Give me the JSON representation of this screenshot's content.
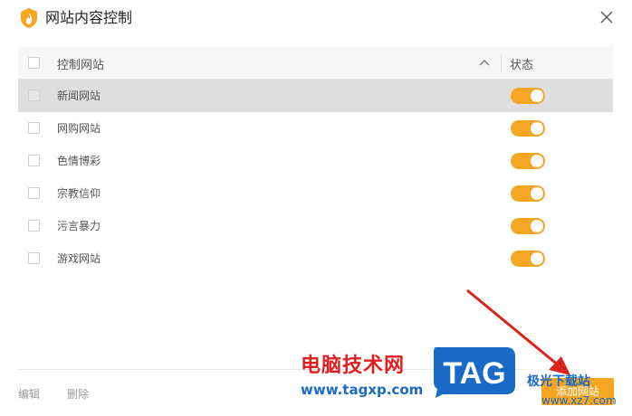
{
  "window": {
    "title": "网站内容控制",
    "icon": "shield-flame-icon",
    "close_icon": "close-icon"
  },
  "table": {
    "headers": {
      "name": "控制网站",
      "status": "状态"
    },
    "sort_icon": "chevron-up-icon",
    "rows": [
      {
        "label": "新闻网站",
        "selected": true,
        "enabled": true
      },
      {
        "label": "网购网站",
        "selected": false,
        "enabled": true
      },
      {
        "label": "色情博彩",
        "selected": false,
        "enabled": true
      },
      {
        "label": "宗教信仰",
        "selected": false,
        "enabled": true
      },
      {
        "label": "污言暴力",
        "selected": false,
        "enabled": true
      },
      {
        "label": "游戏网站",
        "selected": false,
        "enabled": true
      }
    ]
  },
  "footer": {
    "edit_label": "编辑",
    "delete_label": "删除",
    "add_button_label": "添加网站"
  },
  "watermark": {
    "site_name": "电脑技术网",
    "site_url": "www.tagxp.com",
    "tag_text": "TAG",
    "right_text": "极光下载站",
    "right_url": "www.xz7.com"
  },
  "colors": {
    "accent": "#f6a623",
    "selected_row": "#dedede",
    "watermark_red": "#e02020",
    "watermark_blue": "#1a6ac8",
    "arrow": "#d9241c"
  }
}
